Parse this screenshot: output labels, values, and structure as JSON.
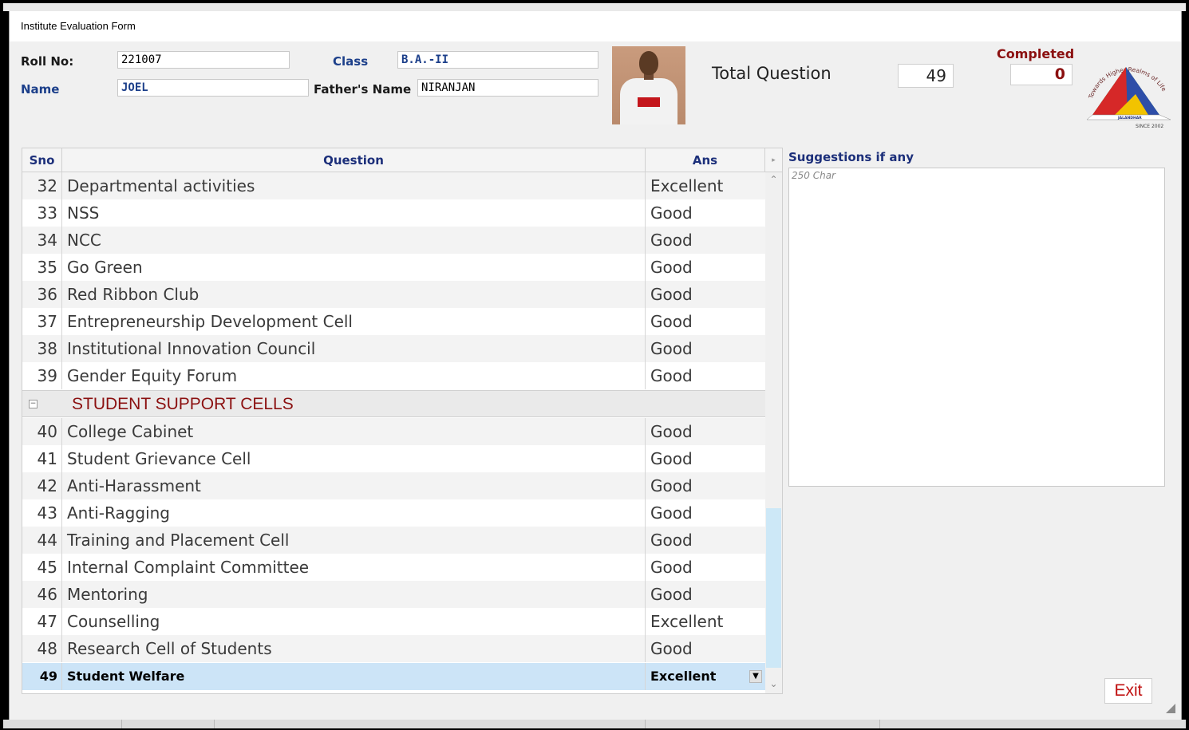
{
  "window": {
    "title": "Institute Evaluation Form"
  },
  "student": {
    "roll_label": "Roll No:",
    "roll_value": "221007",
    "class_label": "Class",
    "class_value": "B.A.-II",
    "name_label": "Name",
    "name_value": "JOEL",
    "father_label": "Father's Name",
    "father_value": "NIRANJAN"
  },
  "stats": {
    "total_label": "Total Question",
    "total_value": "49",
    "completed_label": "Completed",
    "completed_value": "0"
  },
  "logo": {
    "top_text": "Towards Higher Realms of Life",
    "city": "JALANDHAR",
    "since": "SINCE 2002"
  },
  "grid": {
    "headers": {
      "sno": "Sno",
      "question": "Question",
      "ans": "Ans"
    },
    "rows_top": [
      {
        "sno": "32",
        "question": "Departmental activities",
        "ans": "Excellent"
      },
      {
        "sno": "33",
        "question": "NSS",
        "ans": "Good"
      },
      {
        "sno": "34",
        "question": "NCC",
        "ans": "Good"
      },
      {
        "sno": "35",
        "question": "Go Green",
        "ans": "Good"
      },
      {
        "sno": "36",
        "question": "Red Ribbon Club",
        "ans": "Good"
      },
      {
        "sno": "37",
        "question": "Entrepreneurship Development Cell",
        "ans": "Good"
      },
      {
        "sno": "38",
        "question": "Institutional Innovation Council",
        "ans": "Good"
      },
      {
        "sno": "39",
        "question": "Gender Equity Forum",
        "ans": "Good"
      }
    ],
    "group": {
      "title": "STUDENT SUPPORT CELLS",
      "toggle": "⊟"
    },
    "rows_bottom": [
      {
        "sno": "40",
        "question": "College Cabinet",
        "ans": "Good"
      },
      {
        "sno": "41",
        "question": "Student Grievance Cell",
        "ans": "Good"
      },
      {
        "sno": "42",
        "question": "Anti-Harassment",
        "ans": "Good"
      },
      {
        "sno": "43",
        "question": "Anti-Ragging",
        "ans": "Good"
      },
      {
        "sno": "44",
        "question": "Training and Placement Cell",
        "ans": "Good"
      },
      {
        "sno": "45",
        "question": "Internal Complaint Committee",
        "ans": "Good"
      },
      {
        "sno": "46",
        "question": "Mentoring",
        "ans": "Good"
      },
      {
        "sno": "47",
        "question": "Counselling",
        "ans": "Excellent"
      },
      {
        "sno": "48",
        "question": "Research Cell of Students",
        "ans": "Good"
      }
    ],
    "selected": {
      "sno": "49",
      "question": "Student Welfare",
      "ans": "Excellent"
    }
  },
  "suggestions": {
    "label": "Suggestions if any",
    "placeholder": "250 Char",
    "value": ""
  },
  "buttons": {
    "exit": "Exit"
  },
  "colors": {
    "accent_blue": "#1c2f7a",
    "accent_red": "#8b1010",
    "selected_row": "#cce4f7",
    "exit_text": "#c01010"
  },
  "icons": {
    "scroll_up": "scroll-up-icon",
    "scroll_down": "scroll-down-icon",
    "dropdown": "dropdown-arrow-icon",
    "collapse": "collapse-icon",
    "resize": "resize-grip-icon"
  }
}
